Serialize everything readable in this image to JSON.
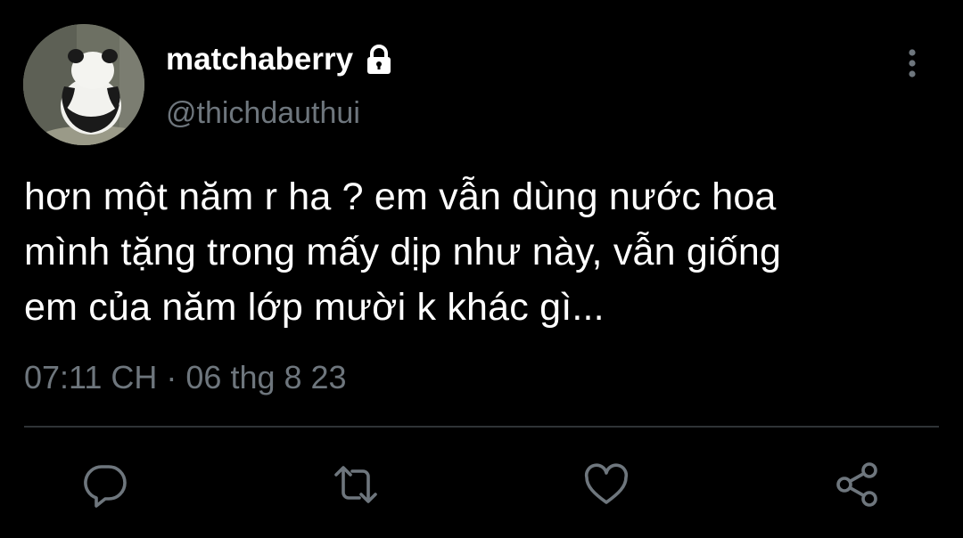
{
  "tweet": {
    "author": {
      "display_name": "matchaberry",
      "handle": "@thichdauthui",
      "protected": true
    },
    "text_lines": [
      "hơn một năm r ha ? em vẫn dùng nước hoa",
      "mình tặng trong mấy dịp như này, vẫn giống",
      "em của năm lớp mười k khác gì..."
    ],
    "timestamp": "07:11 CH · 06 thg 8 23",
    "actions": [
      "reply",
      "retweet",
      "like",
      "share"
    ]
  },
  "icons": {
    "lock": "lock-icon",
    "more": "more-vertical-icon",
    "reply": "reply-icon",
    "retweet": "retweet-icon",
    "like": "heart-icon",
    "share": "share-icon"
  },
  "colors": {
    "background": "#000000",
    "text": "#ffffff",
    "secondary_text": "#6e767d",
    "divider": "#2f3336"
  }
}
